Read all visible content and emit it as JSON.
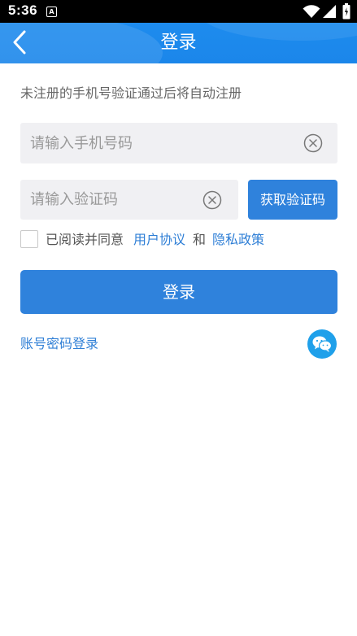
{
  "status_bar": {
    "time": "5:36",
    "app_icon_letter": "A"
  },
  "header": {
    "title": "登录",
    "back_icon": "chevron-left-icon"
  },
  "hint": "未注册的手机号验证通过后将自动注册",
  "phone_input": {
    "placeholder": "请输入手机号码",
    "value": ""
  },
  "code_input": {
    "placeholder": "请输入验证码",
    "value": ""
  },
  "get_code_button": "获取验证码",
  "agreement": {
    "checked": false,
    "prefix": "已阅读并同意",
    "user_agreement": "用户协议",
    "and": "和",
    "privacy_policy": "隐私政策"
  },
  "login_button": "登录",
  "password_login_link": "账号密码登录",
  "wechat_icon": "wechat-icon",
  "colors": {
    "header_blue": "#1f8ff0",
    "button_blue": "#2f82dc",
    "link_blue": "#2f7fd6",
    "wechat_blue": "#1fa0ea",
    "input_bg": "#f0f0f3"
  }
}
